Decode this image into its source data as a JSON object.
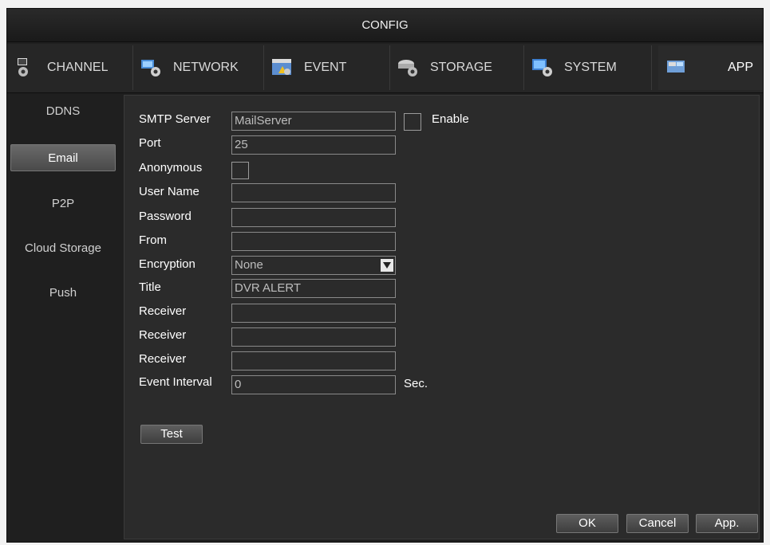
{
  "window": {
    "title": "CONFIG"
  },
  "tabs": [
    {
      "label": "CHANNEL",
      "icon": "channel-icon"
    },
    {
      "label": "NETWORK",
      "icon": "network-icon"
    },
    {
      "label": "EVENT",
      "icon": "event-icon"
    },
    {
      "label": "STORAGE",
      "icon": "storage-icon"
    },
    {
      "label": "SYSTEM",
      "icon": "system-icon"
    },
    {
      "label": "APP",
      "icon": "app-icon",
      "active": true
    }
  ],
  "sidebar": {
    "items": [
      "DDNS",
      "Email",
      "P2P",
      "Cloud Storage",
      "Push"
    ],
    "active": "Email"
  },
  "form": {
    "smtp_server": {
      "label": "SMTP Server",
      "value": "MailServer"
    },
    "enable": {
      "label": "Enable",
      "checked": false
    },
    "port": {
      "label": "Port",
      "value": "25"
    },
    "anonymous": {
      "label": "Anonymous",
      "checked": false
    },
    "user_name": {
      "label": "User Name",
      "value": ""
    },
    "password": {
      "label": "Password",
      "value": ""
    },
    "from": {
      "label": "From",
      "value": ""
    },
    "encryption": {
      "label": "Encryption",
      "value": "None"
    },
    "title": {
      "label": "Title",
      "value": "DVR ALERT"
    },
    "receiver1": {
      "label": "Receiver",
      "value": ""
    },
    "receiver2": {
      "label": "Receiver",
      "value": ""
    },
    "receiver3": {
      "label": "Receiver",
      "value": ""
    },
    "event_interval": {
      "label": "Event Interval",
      "value": "0",
      "unit": "Sec."
    }
  },
  "buttons": {
    "test": "Test",
    "ok": "OK",
    "cancel": "Cancel",
    "apply": "App."
  },
  "colors": {
    "background": "#2b2b2b",
    "text": "#ffffff",
    "field_border": "#8a8a8a"
  }
}
